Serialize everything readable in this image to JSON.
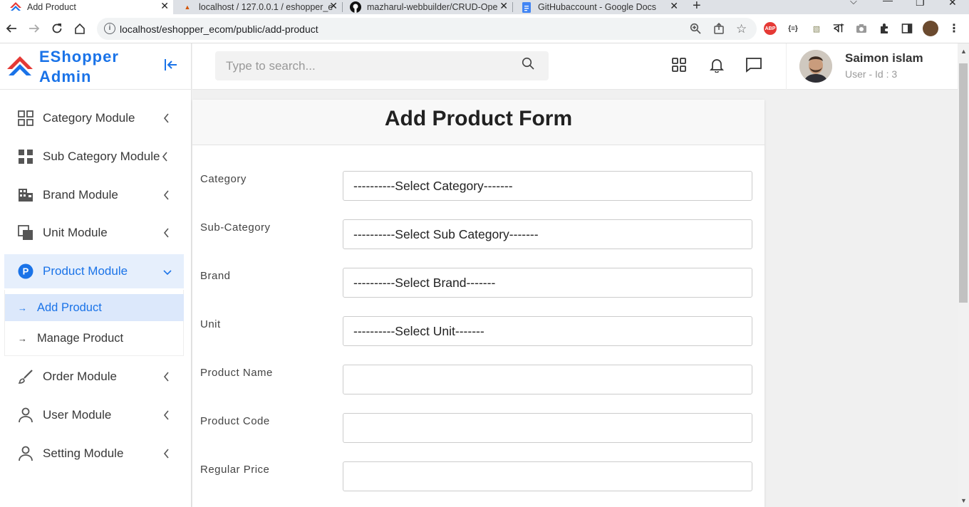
{
  "browser": {
    "tabs": [
      {
        "title": "Add Product",
        "icon": "eshopper-logo-icon",
        "active": true
      },
      {
        "title": "localhost / 127.0.0.1 / eshopper_e",
        "icon": "phpmyadmin-icon",
        "active": false
      },
      {
        "title": "mazharul-webbuilder/CRUD-Ope",
        "icon": "github-icon",
        "active": false
      },
      {
        "title": "GitHubaccount - Google Docs",
        "icon": "google-docs-icon",
        "active": false
      }
    ],
    "url": "localhost/eshopper_ecom/public/add-product"
  },
  "sidebar": {
    "brand": {
      "line1": "EShopper",
      "line2": "Admin"
    },
    "items": [
      {
        "label": "Category Module",
        "icon": "grid-icon"
      },
      {
        "label": "Sub Category Module",
        "icon": "grid-filled-icon"
      },
      {
        "label": "Brand Module",
        "icon": "building-icon"
      },
      {
        "label": "Unit Module",
        "icon": "copy-icon"
      },
      {
        "label": "Product Module",
        "icon": "product-p-icon",
        "active": true
      },
      {
        "label": "Order Module",
        "icon": "brush-icon"
      },
      {
        "label": "User Module",
        "icon": "user-icon"
      },
      {
        "label": "Setting Module",
        "icon": "user-icon"
      }
    ],
    "submenu": [
      {
        "label": "Add Product",
        "active": true
      },
      {
        "label": "Manage Product",
        "active": false
      }
    ]
  },
  "header": {
    "search_placeholder": "Type to search...",
    "user": {
      "name": "Saimon islam",
      "id_text": "User - Id : 3"
    }
  },
  "form": {
    "title": "Add Product Form",
    "fields": [
      {
        "label": "Category",
        "type": "select",
        "value": "----------Select Category-------"
      },
      {
        "label": "Sub-Category",
        "type": "select",
        "value": "----------Select Sub Category-------"
      },
      {
        "label": "Brand",
        "type": "select",
        "value": "----------Select Brand-------"
      },
      {
        "label": "Unit",
        "type": "select",
        "value": "----------Select Unit-------"
      },
      {
        "label": "Product Name",
        "type": "text",
        "value": ""
      },
      {
        "label": "Product Code",
        "type": "text",
        "value": ""
      },
      {
        "label": "Regular Price",
        "type": "text",
        "value": ""
      }
    ]
  },
  "colors": {
    "accent": "#1a73e8",
    "active_bg": "#e6effc",
    "logo_red": "#e53935"
  }
}
